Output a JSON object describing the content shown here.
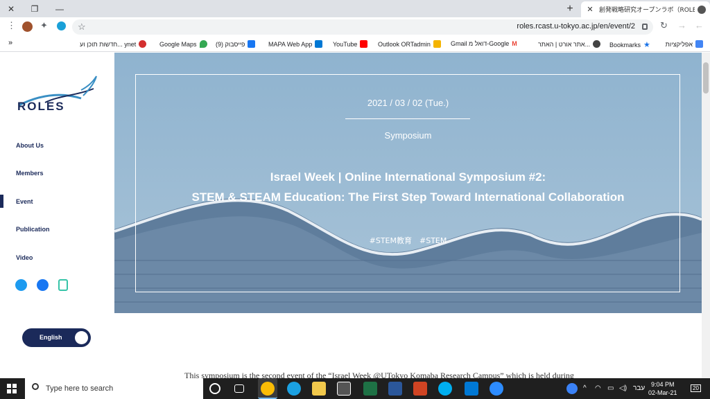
{
  "tabbar": {
    "tab_title": "創発戦略研究オープンラボ（ROLES",
    "new_tab": "+",
    "close": "✕",
    "minimize": "—",
    "restore": "❐"
  },
  "toolbar": {
    "url": "roles.rcast.u-tokyo.ac.jp/en/event/2",
    "star": "☆"
  },
  "bookmarks": [
    {
      "label": "אפליקציות",
      "color": "#4285f4"
    },
    {
      "label": "Bookmarks",
      "color": "#1a73e8"
    },
    {
      "label": "אתר אורט | האתר...",
      "color": "#444444"
    },
    {
      "label": "Gmail דואל מ-Google",
      "color": "#ea4335"
    },
    {
      "label": "Outlook ORTadmin",
      "color": "#f4b400"
    },
    {
      "label": "YouTube",
      "color": "#ff0000"
    },
    {
      "label": "MAPA Web App",
      "color": "#0078d4"
    },
    {
      "label": "(9) פייסבוק",
      "color": "#1877f2"
    },
    {
      "label": "Google Maps",
      "color": "#34a853"
    },
    {
      "label": "חדשות תוכן וע... ynet",
      "color": "#d32f2f"
    }
  ],
  "bookmarks_more": "»",
  "sidebar": {
    "logo_text": "ROLES",
    "nav": [
      "About Us",
      "Members",
      "Event",
      "Publication",
      "Video"
    ],
    "active": "Event",
    "language": "English"
  },
  "hero": {
    "date": "2021 / 03 / 02 (Tue.)",
    "category": "Symposium",
    "title_line1": "Israel Week | Online International Symposium #2:",
    "title_line2": "STEM & STEAM Education: The First Step Toward International Collaboration",
    "tags": "#STEM教育　#STEM"
  },
  "body": {
    "intro": "This symposium is the second event of the “Israel Week @UTokyo Komaba Research Campus” which is held during"
  },
  "taskbar": {
    "search_placeholder": "Type here to search",
    "lang": "עבר",
    "time": "9:04 PM",
    "date": "02-Mar-21",
    "notifications": "20"
  },
  "colors": {
    "navy": "#1b2a5a",
    "hero_sky": "#8fb3cf"
  }
}
